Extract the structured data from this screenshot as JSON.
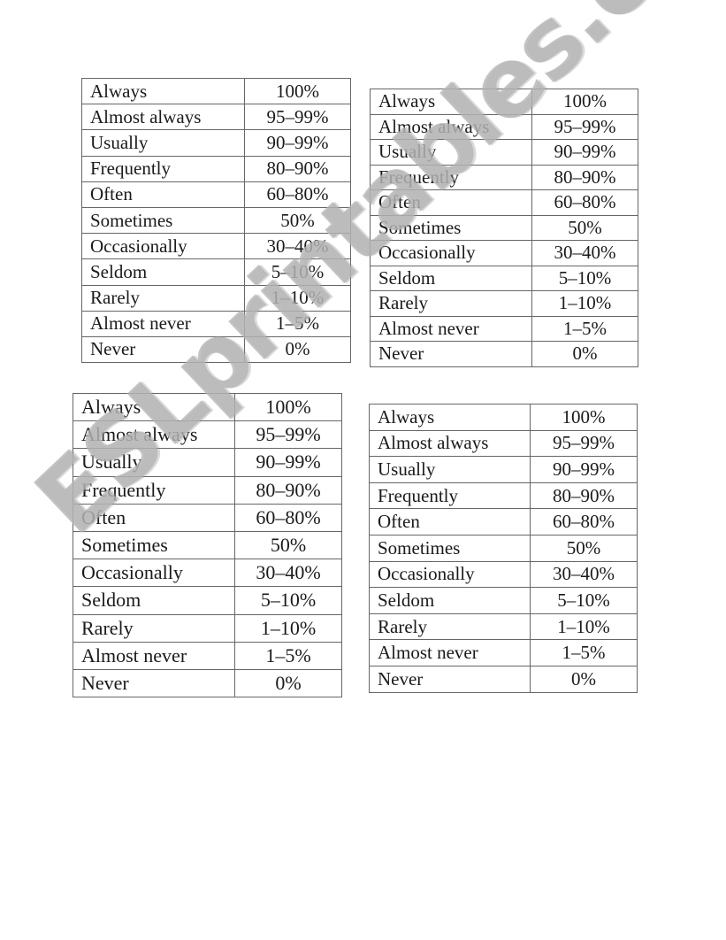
{
  "tables": [
    {
      "rows": [
        {
          "word": "Always",
          "percent": "100%"
        },
        {
          "word": "Almost always",
          "percent": "95–99%"
        },
        {
          "word": "Usually",
          "percent": "90–99%"
        },
        {
          "word": "Frequently",
          "percent": "80–90%"
        },
        {
          "word": "Often",
          "percent": "60–80%"
        },
        {
          "word": "Sometimes",
          "percent": "50%"
        },
        {
          "word": "Occasionally",
          "percent": "30–40%"
        },
        {
          "word": "Seldom",
          "percent": "5–10%"
        },
        {
          "word": "Rarely",
          "percent": "1–10%"
        },
        {
          "word": "Almost never",
          "percent": "1–5%"
        },
        {
          "word": "Never",
          "percent": "0%"
        }
      ]
    },
    {
      "rows": [
        {
          "word": "Always",
          "percent": "100%"
        },
        {
          "word": "Almost always",
          "percent": "95–99%"
        },
        {
          "word": "Usually",
          "percent": "90–99%"
        },
        {
          "word": "Frequently",
          "percent": "80–90%"
        },
        {
          "word": "Often",
          "percent": "60–80%"
        },
        {
          "word": "Sometimes",
          "percent": "50%"
        },
        {
          "word": "Occasionally",
          "percent": "30–40%"
        },
        {
          "word": "Seldom",
          "percent": "5–10%"
        },
        {
          "word": "Rarely",
          "percent": "1–10%"
        },
        {
          "word": "Almost never",
          "percent": "1–5%"
        },
        {
          "word": "Never",
          "percent": "0%"
        }
      ]
    },
    {
      "rows": [
        {
          "word": "Always",
          "percent": "100%"
        },
        {
          "word": "Almost always",
          "percent": "95–99%"
        },
        {
          "word": "Usually",
          "percent": "90–99%"
        },
        {
          "word": "Frequently",
          "percent": "80–90%"
        },
        {
          "word": "Often",
          "percent": "60–80%"
        },
        {
          "word": "Sometimes",
          "percent": "50%"
        },
        {
          "word": "Occasionally",
          "percent": "30–40%"
        },
        {
          "word": "Seldom",
          "percent": "5–10%"
        },
        {
          "word": "Rarely",
          "percent": "1–10%"
        },
        {
          "word": "Almost never",
          "percent": "1–5%"
        },
        {
          "word": "Never",
          "percent": "0%"
        }
      ]
    },
    {
      "rows": [
        {
          "word": "Always",
          "percent": "100%"
        },
        {
          "word": "Almost always",
          "percent": "95–99%"
        },
        {
          "word": "Usually",
          "percent": "90–99%"
        },
        {
          "word": "Frequently",
          "percent": "80–90%"
        },
        {
          "word": "Often",
          "percent": "60–80%"
        },
        {
          "word": "Sometimes",
          "percent": "50%"
        },
        {
          "word": "Occasionally",
          "percent": "30–40%"
        },
        {
          "word": "Seldom",
          "percent": "5–10%"
        },
        {
          "word": "Rarely",
          "percent": "1–10%"
        },
        {
          "word": "Almost never",
          "percent": "1–5%"
        },
        {
          "word": "Never",
          "percent": "0%"
        }
      ]
    }
  ],
  "watermark": {
    "text": "ESLprintables.com",
    "color": "#c8c8c8"
  }
}
